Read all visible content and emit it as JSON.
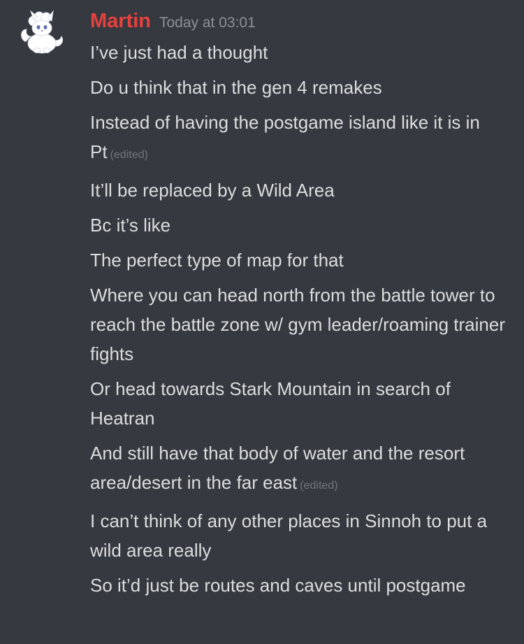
{
  "author": {
    "username": "Martin",
    "timestamp": "Today at 03:01",
    "avatar_icon": "white-fox-avatar-icon",
    "name_color": "#e7413f"
  },
  "edited_label": "(edited)",
  "messages": [
    {
      "text": "I’ve just had a thought",
      "edited": false
    },
    {
      "text": "Do u think that in the gen 4 remakes",
      "edited": false
    },
    {
      "text": "Instead of having the postgame island like it is in Pt",
      "edited": true
    },
    {
      "text": "It’ll be replaced by a Wild Area",
      "edited": false
    },
    {
      "text": "Bc it’s like",
      "edited": false
    },
    {
      "text": "The perfect type of map for that",
      "edited": false
    },
    {
      "text": "Where you can head north from the battle tower to reach the battle zone w/ gym leader/roaming trainer fights",
      "edited": false
    },
    {
      "text": "Or head towards Stark Mountain in search of Heatran",
      "edited": false
    },
    {
      "text": "And still have that body of water and the resort area/desert in the far east",
      "edited": true
    },
    {
      "text": "I can’t think of any other places in Sinnoh to put a wild area really",
      "edited": false
    },
    {
      "text": "So it’d just be routes and caves until postgame",
      "edited": false
    }
  ]
}
